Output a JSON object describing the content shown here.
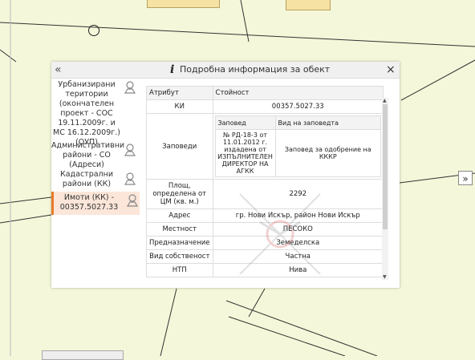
{
  "popup": {
    "title": "Подробна информация за обект",
    "collapse_label": "«",
    "close_label": "×",
    "info_label": "i"
  },
  "map": {
    "expand_label": "»"
  },
  "sidebar": {
    "items": [
      {
        "label": "Урбанизирани територии (окончателен проект - СОС 19.11.2009г. и МС 16.12.2009г.) (ОУП)",
        "icon": "layer-info-icon"
      },
      {
        "label": "Административни райони - СО (Адреси)",
        "icon": "layer-info-icon"
      },
      {
        "label": "Кадастрални райони (КК)",
        "icon": "layer-info-icon"
      },
      {
        "label": "Имоти (КК) - 00357.5027.33",
        "icon": "layer-info-icon",
        "active": true
      }
    ]
  },
  "table": {
    "headers": [
      "Атрибут",
      "Стойност"
    ],
    "rows": [
      {
        "attr": "КИ",
        "value": "00357.5027.33"
      },
      {
        "attr": "Заповеди"
      },
      {
        "attr": "Площ, определена от ЦМ (кв. м.)",
        "value": "2292"
      },
      {
        "attr": "Адрес",
        "value": "гр. Нови Искър, район Нови Искър"
      },
      {
        "attr": "Местност",
        "value": "ПЕСОКО"
      },
      {
        "attr": "Предназначение",
        "value": "Земеделска"
      },
      {
        "attr": "Вид собственост",
        "value": "Частна"
      },
      {
        "attr": "НТП",
        "value": "Нива"
      }
    ],
    "orders": {
      "headers": [
        "Заповед",
        "Вид на заповедта"
      ],
      "rows": [
        {
          "order": "№ РД-18-3 от 11.01.2012 г. издадена от ИЗПЪЛНИТЕЛЕН ДИРЕКТОР НА АГКК",
          "type": "Заповед за одобрение на КККР"
        }
      ]
    }
  },
  "colors": {
    "map_background": "#f4f7d9",
    "parcel_fill": "#f6e3a4",
    "active_accent": "#e87a2a",
    "active_background": "#fbe6d9"
  }
}
